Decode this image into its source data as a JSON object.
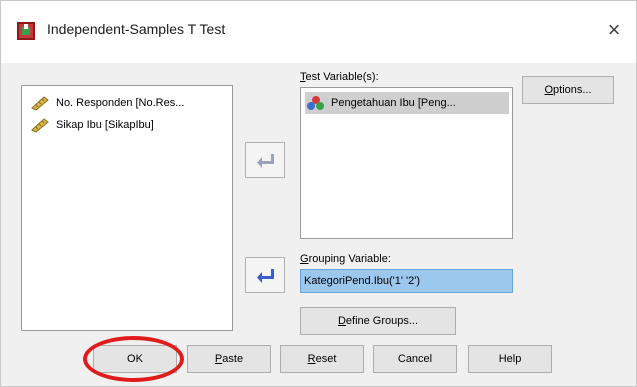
{
  "window": {
    "title": "Independent-Samples T Test",
    "close_glyph": "×",
    "icon": "spss-dialog-icon"
  },
  "source_list": {
    "items": [
      {
        "label": "No. Responden [No.Res...",
        "icon": "scale-ruler-icon"
      },
      {
        "label": "Sikap Ibu [SikapIbu]",
        "icon": "scale-ruler-icon"
      }
    ]
  },
  "test_variables": {
    "label_underlined": "T",
    "label_rest": "est Variable(s):",
    "items": [
      {
        "label": "Pengetahuan Ibu [Peng...",
        "icon": "nominal-balls-icon"
      }
    ]
  },
  "grouping": {
    "label_underlined": "G",
    "label_rest": "rouping Variable:",
    "value": "KategoriPend.Ibu('1' '2')"
  },
  "buttons": {
    "options": {
      "u": "O",
      "rest": "ptions..."
    },
    "define_groups": {
      "u": "D",
      "rest": "efine Groups..."
    },
    "ok": {
      "label": "OK"
    },
    "paste": {
      "u": "P",
      "rest": "aste"
    },
    "reset": {
      "u": "R",
      "rest": "eset"
    },
    "cancel": {
      "label": "Cancel"
    },
    "help": {
      "label": "Help"
    }
  },
  "annotation": {
    "color": "#e01b1b",
    "target": "ok-button"
  },
  "colors": {
    "selection": "#cfcfcf",
    "grouping_highlight": "#9dc8ee",
    "arrow_blue": "#3a5fcd"
  }
}
